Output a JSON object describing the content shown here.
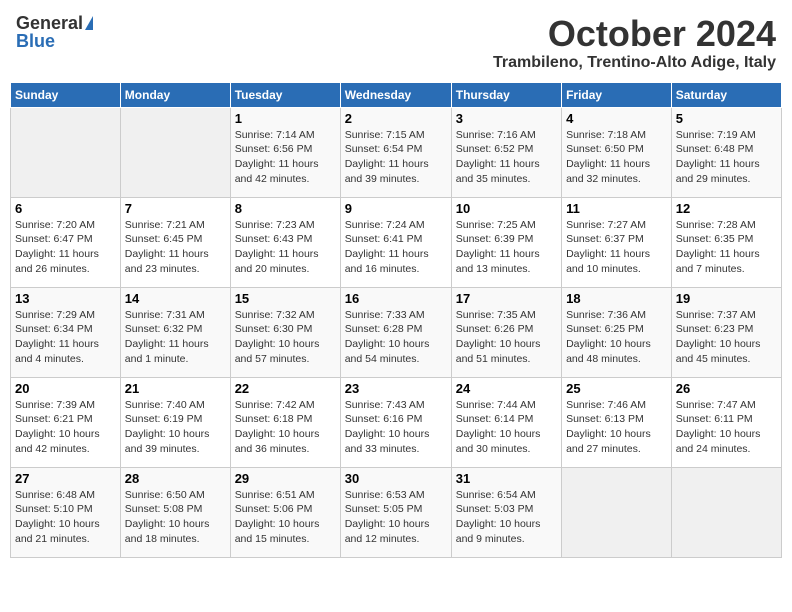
{
  "header": {
    "logo_general": "General",
    "logo_blue": "Blue",
    "month_title": "October 2024",
    "location": "Trambileno, Trentino-Alto Adige, Italy"
  },
  "weekdays": [
    "Sunday",
    "Monday",
    "Tuesday",
    "Wednesday",
    "Thursday",
    "Friday",
    "Saturday"
  ],
  "weeks": [
    [
      {
        "day": "",
        "sunrise": "",
        "sunset": "",
        "daylight": ""
      },
      {
        "day": "",
        "sunrise": "",
        "sunset": "",
        "daylight": ""
      },
      {
        "day": "1",
        "sunrise": "Sunrise: 7:14 AM",
        "sunset": "Sunset: 6:56 PM",
        "daylight": "Daylight: 11 hours and 42 minutes."
      },
      {
        "day": "2",
        "sunrise": "Sunrise: 7:15 AM",
        "sunset": "Sunset: 6:54 PM",
        "daylight": "Daylight: 11 hours and 39 minutes."
      },
      {
        "day": "3",
        "sunrise": "Sunrise: 7:16 AM",
        "sunset": "Sunset: 6:52 PM",
        "daylight": "Daylight: 11 hours and 35 minutes."
      },
      {
        "day": "4",
        "sunrise": "Sunrise: 7:18 AM",
        "sunset": "Sunset: 6:50 PM",
        "daylight": "Daylight: 11 hours and 32 minutes."
      },
      {
        "day": "5",
        "sunrise": "Sunrise: 7:19 AM",
        "sunset": "Sunset: 6:48 PM",
        "daylight": "Daylight: 11 hours and 29 minutes."
      }
    ],
    [
      {
        "day": "6",
        "sunrise": "Sunrise: 7:20 AM",
        "sunset": "Sunset: 6:47 PM",
        "daylight": "Daylight: 11 hours and 26 minutes."
      },
      {
        "day": "7",
        "sunrise": "Sunrise: 7:21 AM",
        "sunset": "Sunset: 6:45 PM",
        "daylight": "Daylight: 11 hours and 23 minutes."
      },
      {
        "day": "8",
        "sunrise": "Sunrise: 7:23 AM",
        "sunset": "Sunset: 6:43 PM",
        "daylight": "Daylight: 11 hours and 20 minutes."
      },
      {
        "day": "9",
        "sunrise": "Sunrise: 7:24 AM",
        "sunset": "Sunset: 6:41 PM",
        "daylight": "Daylight: 11 hours and 16 minutes."
      },
      {
        "day": "10",
        "sunrise": "Sunrise: 7:25 AM",
        "sunset": "Sunset: 6:39 PM",
        "daylight": "Daylight: 11 hours and 13 minutes."
      },
      {
        "day": "11",
        "sunrise": "Sunrise: 7:27 AM",
        "sunset": "Sunset: 6:37 PM",
        "daylight": "Daylight: 11 hours and 10 minutes."
      },
      {
        "day": "12",
        "sunrise": "Sunrise: 7:28 AM",
        "sunset": "Sunset: 6:35 PM",
        "daylight": "Daylight: 11 hours and 7 minutes."
      }
    ],
    [
      {
        "day": "13",
        "sunrise": "Sunrise: 7:29 AM",
        "sunset": "Sunset: 6:34 PM",
        "daylight": "Daylight: 11 hours and 4 minutes."
      },
      {
        "day": "14",
        "sunrise": "Sunrise: 7:31 AM",
        "sunset": "Sunset: 6:32 PM",
        "daylight": "Daylight: 11 hours and 1 minute."
      },
      {
        "day": "15",
        "sunrise": "Sunrise: 7:32 AM",
        "sunset": "Sunset: 6:30 PM",
        "daylight": "Daylight: 10 hours and 57 minutes."
      },
      {
        "day": "16",
        "sunrise": "Sunrise: 7:33 AM",
        "sunset": "Sunset: 6:28 PM",
        "daylight": "Daylight: 10 hours and 54 minutes."
      },
      {
        "day": "17",
        "sunrise": "Sunrise: 7:35 AM",
        "sunset": "Sunset: 6:26 PM",
        "daylight": "Daylight: 10 hours and 51 minutes."
      },
      {
        "day": "18",
        "sunrise": "Sunrise: 7:36 AM",
        "sunset": "Sunset: 6:25 PM",
        "daylight": "Daylight: 10 hours and 48 minutes."
      },
      {
        "day": "19",
        "sunrise": "Sunrise: 7:37 AM",
        "sunset": "Sunset: 6:23 PM",
        "daylight": "Daylight: 10 hours and 45 minutes."
      }
    ],
    [
      {
        "day": "20",
        "sunrise": "Sunrise: 7:39 AM",
        "sunset": "Sunset: 6:21 PM",
        "daylight": "Daylight: 10 hours and 42 minutes."
      },
      {
        "day": "21",
        "sunrise": "Sunrise: 7:40 AM",
        "sunset": "Sunset: 6:19 PM",
        "daylight": "Daylight: 10 hours and 39 minutes."
      },
      {
        "day": "22",
        "sunrise": "Sunrise: 7:42 AM",
        "sunset": "Sunset: 6:18 PM",
        "daylight": "Daylight: 10 hours and 36 minutes."
      },
      {
        "day": "23",
        "sunrise": "Sunrise: 7:43 AM",
        "sunset": "Sunset: 6:16 PM",
        "daylight": "Daylight: 10 hours and 33 minutes."
      },
      {
        "day": "24",
        "sunrise": "Sunrise: 7:44 AM",
        "sunset": "Sunset: 6:14 PM",
        "daylight": "Daylight: 10 hours and 30 minutes."
      },
      {
        "day": "25",
        "sunrise": "Sunrise: 7:46 AM",
        "sunset": "Sunset: 6:13 PM",
        "daylight": "Daylight: 10 hours and 27 minutes."
      },
      {
        "day": "26",
        "sunrise": "Sunrise: 7:47 AM",
        "sunset": "Sunset: 6:11 PM",
        "daylight": "Daylight: 10 hours and 24 minutes."
      }
    ],
    [
      {
        "day": "27",
        "sunrise": "Sunrise: 6:48 AM",
        "sunset": "Sunset: 5:10 PM",
        "daylight": "Daylight: 10 hours and 21 minutes."
      },
      {
        "day": "28",
        "sunrise": "Sunrise: 6:50 AM",
        "sunset": "Sunset: 5:08 PM",
        "daylight": "Daylight: 10 hours and 18 minutes."
      },
      {
        "day": "29",
        "sunrise": "Sunrise: 6:51 AM",
        "sunset": "Sunset: 5:06 PM",
        "daylight": "Daylight: 10 hours and 15 minutes."
      },
      {
        "day": "30",
        "sunrise": "Sunrise: 6:53 AM",
        "sunset": "Sunset: 5:05 PM",
        "daylight": "Daylight: 10 hours and 12 minutes."
      },
      {
        "day": "31",
        "sunrise": "Sunrise: 6:54 AM",
        "sunset": "Sunset: 5:03 PM",
        "daylight": "Daylight: 10 hours and 9 minutes."
      },
      {
        "day": "",
        "sunrise": "",
        "sunset": "",
        "daylight": ""
      },
      {
        "day": "",
        "sunrise": "",
        "sunset": "",
        "daylight": ""
      }
    ]
  ]
}
